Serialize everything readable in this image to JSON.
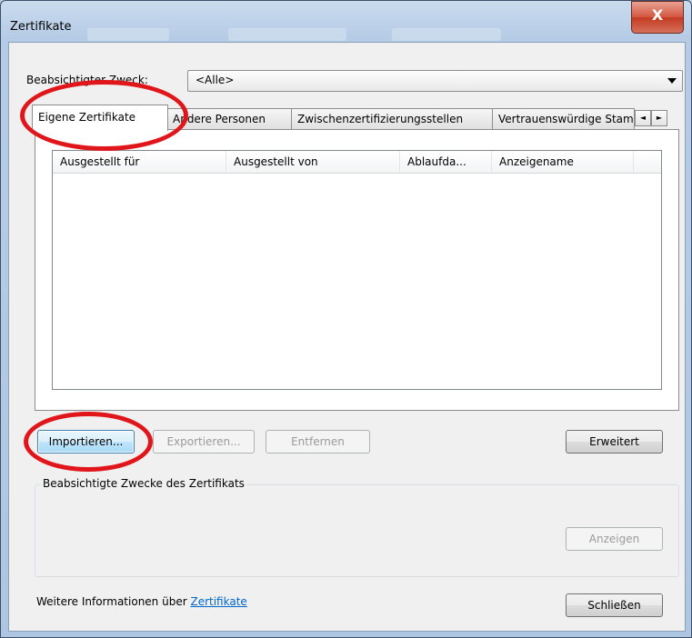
{
  "window": {
    "title": "Zertifikate",
    "close_glyph": "X"
  },
  "purpose": {
    "label": "Beabsichtigter Zweck:",
    "value": "<Alle>"
  },
  "tabs": [
    {
      "label": "Eigene Zertifikate",
      "active": true
    },
    {
      "label": "Andere Personen",
      "active": false
    },
    {
      "label": "Zwischenzertifizierungsstellen",
      "active": false
    },
    {
      "label": "Vertrauenswürdige Stammzertifizierungsstellen",
      "active": false
    }
  ],
  "tab_scroll": {
    "left_icon": "arrow-left-icon",
    "right_icon": "arrow-right-icon",
    "left_glyph": "◄",
    "right_glyph": "►"
  },
  "certificate_list": {
    "columns": [
      "Ausgestellt für",
      "Ausgestellt von",
      "Ablaufda...",
      "Anzeigename"
    ],
    "rows": []
  },
  "buttons": {
    "import": "Importieren...",
    "export": "Exportieren...",
    "remove": "Entfernen",
    "advanced": "Erweitert",
    "view": "Anzeigen",
    "close": "Schließen"
  },
  "purposes_group": {
    "legend": "Beabsichtigte Zwecke des Zertifikats"
  },
  "footer": {
    "text": "Weitere Informationen über",
    "link": "Zertifikate"
  },
  "colors": {
    "annotation": "#e0161a",
    "link": "#0066cc",
    "window_frame": "#b6cce6"
  }
}
